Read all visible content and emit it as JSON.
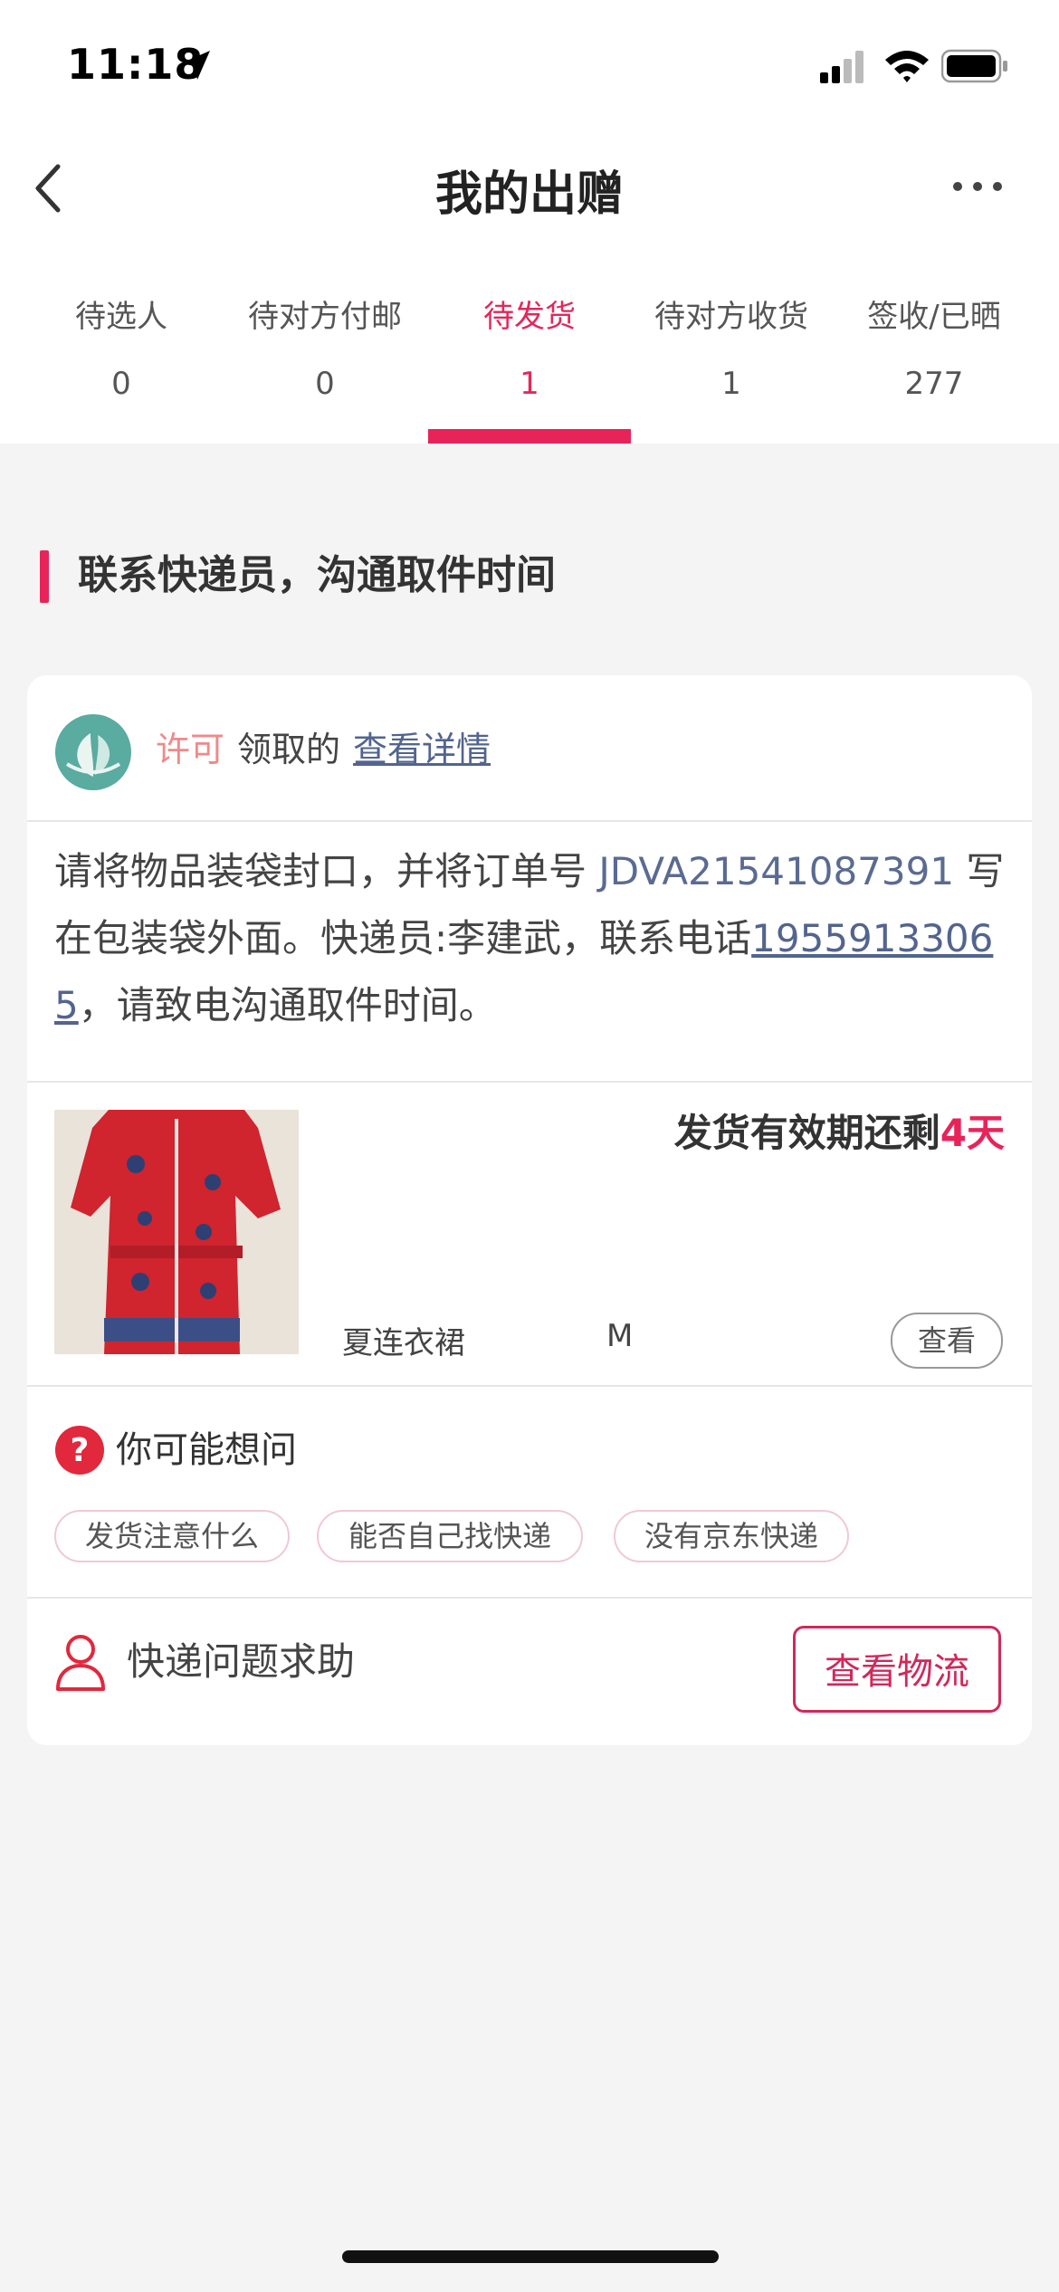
{
  "status_bar": {
    "time": "11:18"
  },
  "nav": {
    "title": "我的出赠"
  },
  "tabs": [
    {
      "label": "待选人",
      "count": "0",
      "active": false
    },
    {
      "label": "待对方付邮",
      "count": "0",
      "active": false
    },
    {
      "label": "待发货",
      "count": "1",
      "active": true
    },
    {
      "label": "待对方收货",
      "count": "1",
      "active": false
    },
    {
      "label": "签收/已晒",
      "count": "277",
      "active": false
    }
  ],
  "section": {
    "heading": "联系快递员，沟通取件时间"
  },
  "card": {
    "from": {
      "name": "许可",
      "text": "领取的",
      "link": "查看详情"
    },
    "instruction": {
      "part1": "请将物品装袋封口，并将订单号 ",
      "order_no": "JDVA21541087391",
      "part2": " 写在包装袋外面。快递员:李建武，联系电话",
      "phone": "19559133065",
      "part3": "，请致电沟通取件时间。"
    },
    "product": {
      "deadline_prefix": "发货有效期还剩",
      "deadline_days": "4天",
      "name": "夏连衣裙",
      "size": "M",
      "view_label": "查看"
    },
    "faq": {
      "title": "你可能想问",
      "chips": [
        "发货注意什么",
        "能否自己找快递",
        "没有京东快递"
      ]
    },
    "help": {
      "text": "快递问题求助",
      "button": "查看物流"
    }
  },
  "colors": {
    "accent": "#e8235a",
    "link": "#52648f",
    "from_name": "#ef8a8a"
  }
}
